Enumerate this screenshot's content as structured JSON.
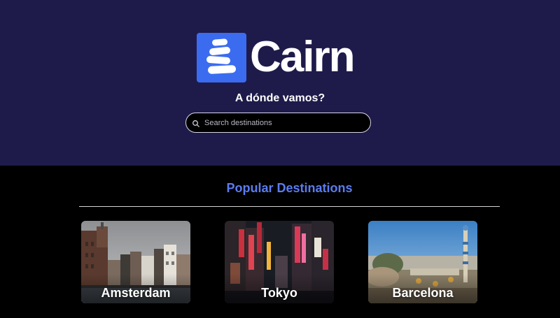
{
  "brand": {
    "name": "Cairn",
    "logo_color": "#3b6cf0"
  },
  "hero": {
    "tagline": "A dónde vamos?",
    "background": "#1e1b4b"
  },
  "search": {
    "placeholder": "Search destinations",
    "icon": "search-icon"
  },
  "popular": {
    "title": "Popular Destinations",
    "destinations": [
      {
        "name": "Amsterdam"
      },
      {
        "name": "Tokyo"
      },
      {
        "name": "Barcelona"
      }
    ]
  }
}
